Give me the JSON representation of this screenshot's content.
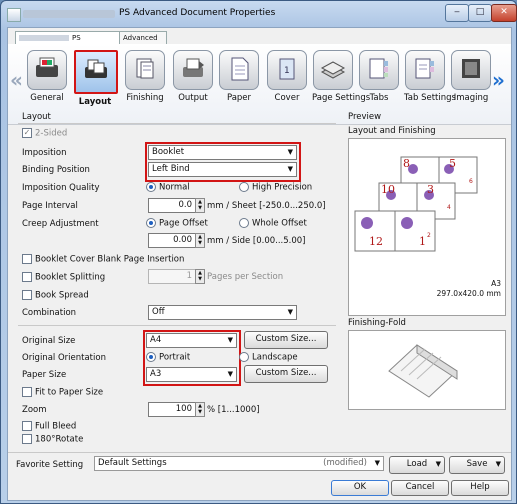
{
  "window": {
    "title": "PS Advanced Document Properties",
    "min_glyph": "‒",
    "max_glyph": "□",
    "close_glyph": "✕"
  },
  "tabs": [
    {
      "label": "PS"
    },
    {
      "label": "Advanced"
    }
  ],
  "ribbon": {
    "left_arrow": "«",
    "right_arrow": "»",
    "items": [
      {
        "label": "General",
        "icon": "printer-photo-icon",
        "selected": false
      },
      {
        "label": "Layout",
        "icon": "layout-pages-icon",
        "selected": true
      },
      {
        "label": "Finishing",
        "icon": "finishing-icon",
        "selected": false
      },
      {
        "label": "Output",
        "icon": "output-icon",
        "selected": false
      },
      {
        "label": "Paper",
        "icon": "paper-icon",
        "selected": false
      },
      {
        "label": "Cover",
        "icon": "cover-icon",
        "selected": false
      },
      {
        "label": "Page Settings",
        "icon": "page-settings-icon",
        "selected": false
      },
      {
        "label": "Tabs",
        "icon": "tabs-icon",
        "selected": false
      },
      {
        "label": "Tab Settings",
        "icon": "tab-settings-icon",
        "selected": false
      },
      {
        "label": "Imaging",
        "icon": "imaging-icon",
        "selected": false
      }
    ]
  },
  "layout": {
    "section_title": "Layout",
    "two_sided": {
      "label": "2-Sided",
      "checked": true
    },
    "imposition": {
      "label": "Imposition",
      "value": "Booklet"
    },
    "binding_position": {
      "label": "Binding Position",
      "value": "Left Bind"
    },
    "imposition_quality": {
      "label": "Imposition Quality",
      "option_normal": "Normal",
      "option_high": "High Precision",
      "selected": "Normal"
    },
    "page_interval": {
      "label": "Page Interval",
      "value": "0.0",
      "unit": "mm / Sheet [-250.0...250.0]"
    },
    "creep_adjustment": {
      "label": "Creep Adjustment",
      "option_page": "Page Offset",
      "option_whole": "Whole Offset",
      "selected": "Page Offset",
      "value": "0.00",
      "unit": "mm / Side [0.00...5.00]"
    },
    "booklet_cover_blank": {
      "label": "Booklet Cover Blank Page Insertion",
      "checked": false
    },
    "booklet_splitting": {
      "label": "Booklet Splitting",
      "checked": false,
      "value": "1",
      "unit": "Pages per Section"
    },
    "book_spread": {
      "label": "Book Spread",
      "checked": false
    },
    "combination": {
      "label": "Combination",
      "value": "Off"
    },
    "original_size": {
      "label": "Original Size",
      "value": "A4",
      "button": "Custom Size..."
    },
    "original_orientation": {
      "label": "Original Orientation",
      "option_portrait": "Portrait",
      "option_landscape": "Landscape",
      "selected": "Portrait"
    },
    "paper_size": {
      "label": "Paper Size",
      "value": "A3",
      "button": "Custom Size..."
    },
    "fit_to_paper": {
      "label": "Fit to Paper Size",
      "checked": false
    },
    "zoom": {
      "label": "Zoom",
      "value": "100",
      "unit": "% [1...1000]"
    },
    "full_bleed": {
      "label": "Full Bleed",
      "checked": false
    },
    "rotate180": {
      "label": "180°Rotate",
      "checked": false
    }
  },
  "preview": {
    "section_title": "Preview",
    "layout_title": "Layout and Finishing",
    "page_numbers": [
      "8",
      "5",
      "10",
      "3",
      "12",
      "1"
    ],
    "small_numbers": [
      "6",
      "4",
      "2"
    ],
    "paper_label": "A3",
    "paper_dims": "297.0x420.0 mm",
    "fold_title": "Finishing-Fold"
  },
  "favorite": {
    "label": "Favorite Setting",
    "value": "Default Settings",
    "modified": "(modified)",
    "load": "Load",
    "save": "Save"
  },
  "footer": {
    "ok": "OK",
    "cancel": "Cancel",
    "help": "Help"
  }
}
